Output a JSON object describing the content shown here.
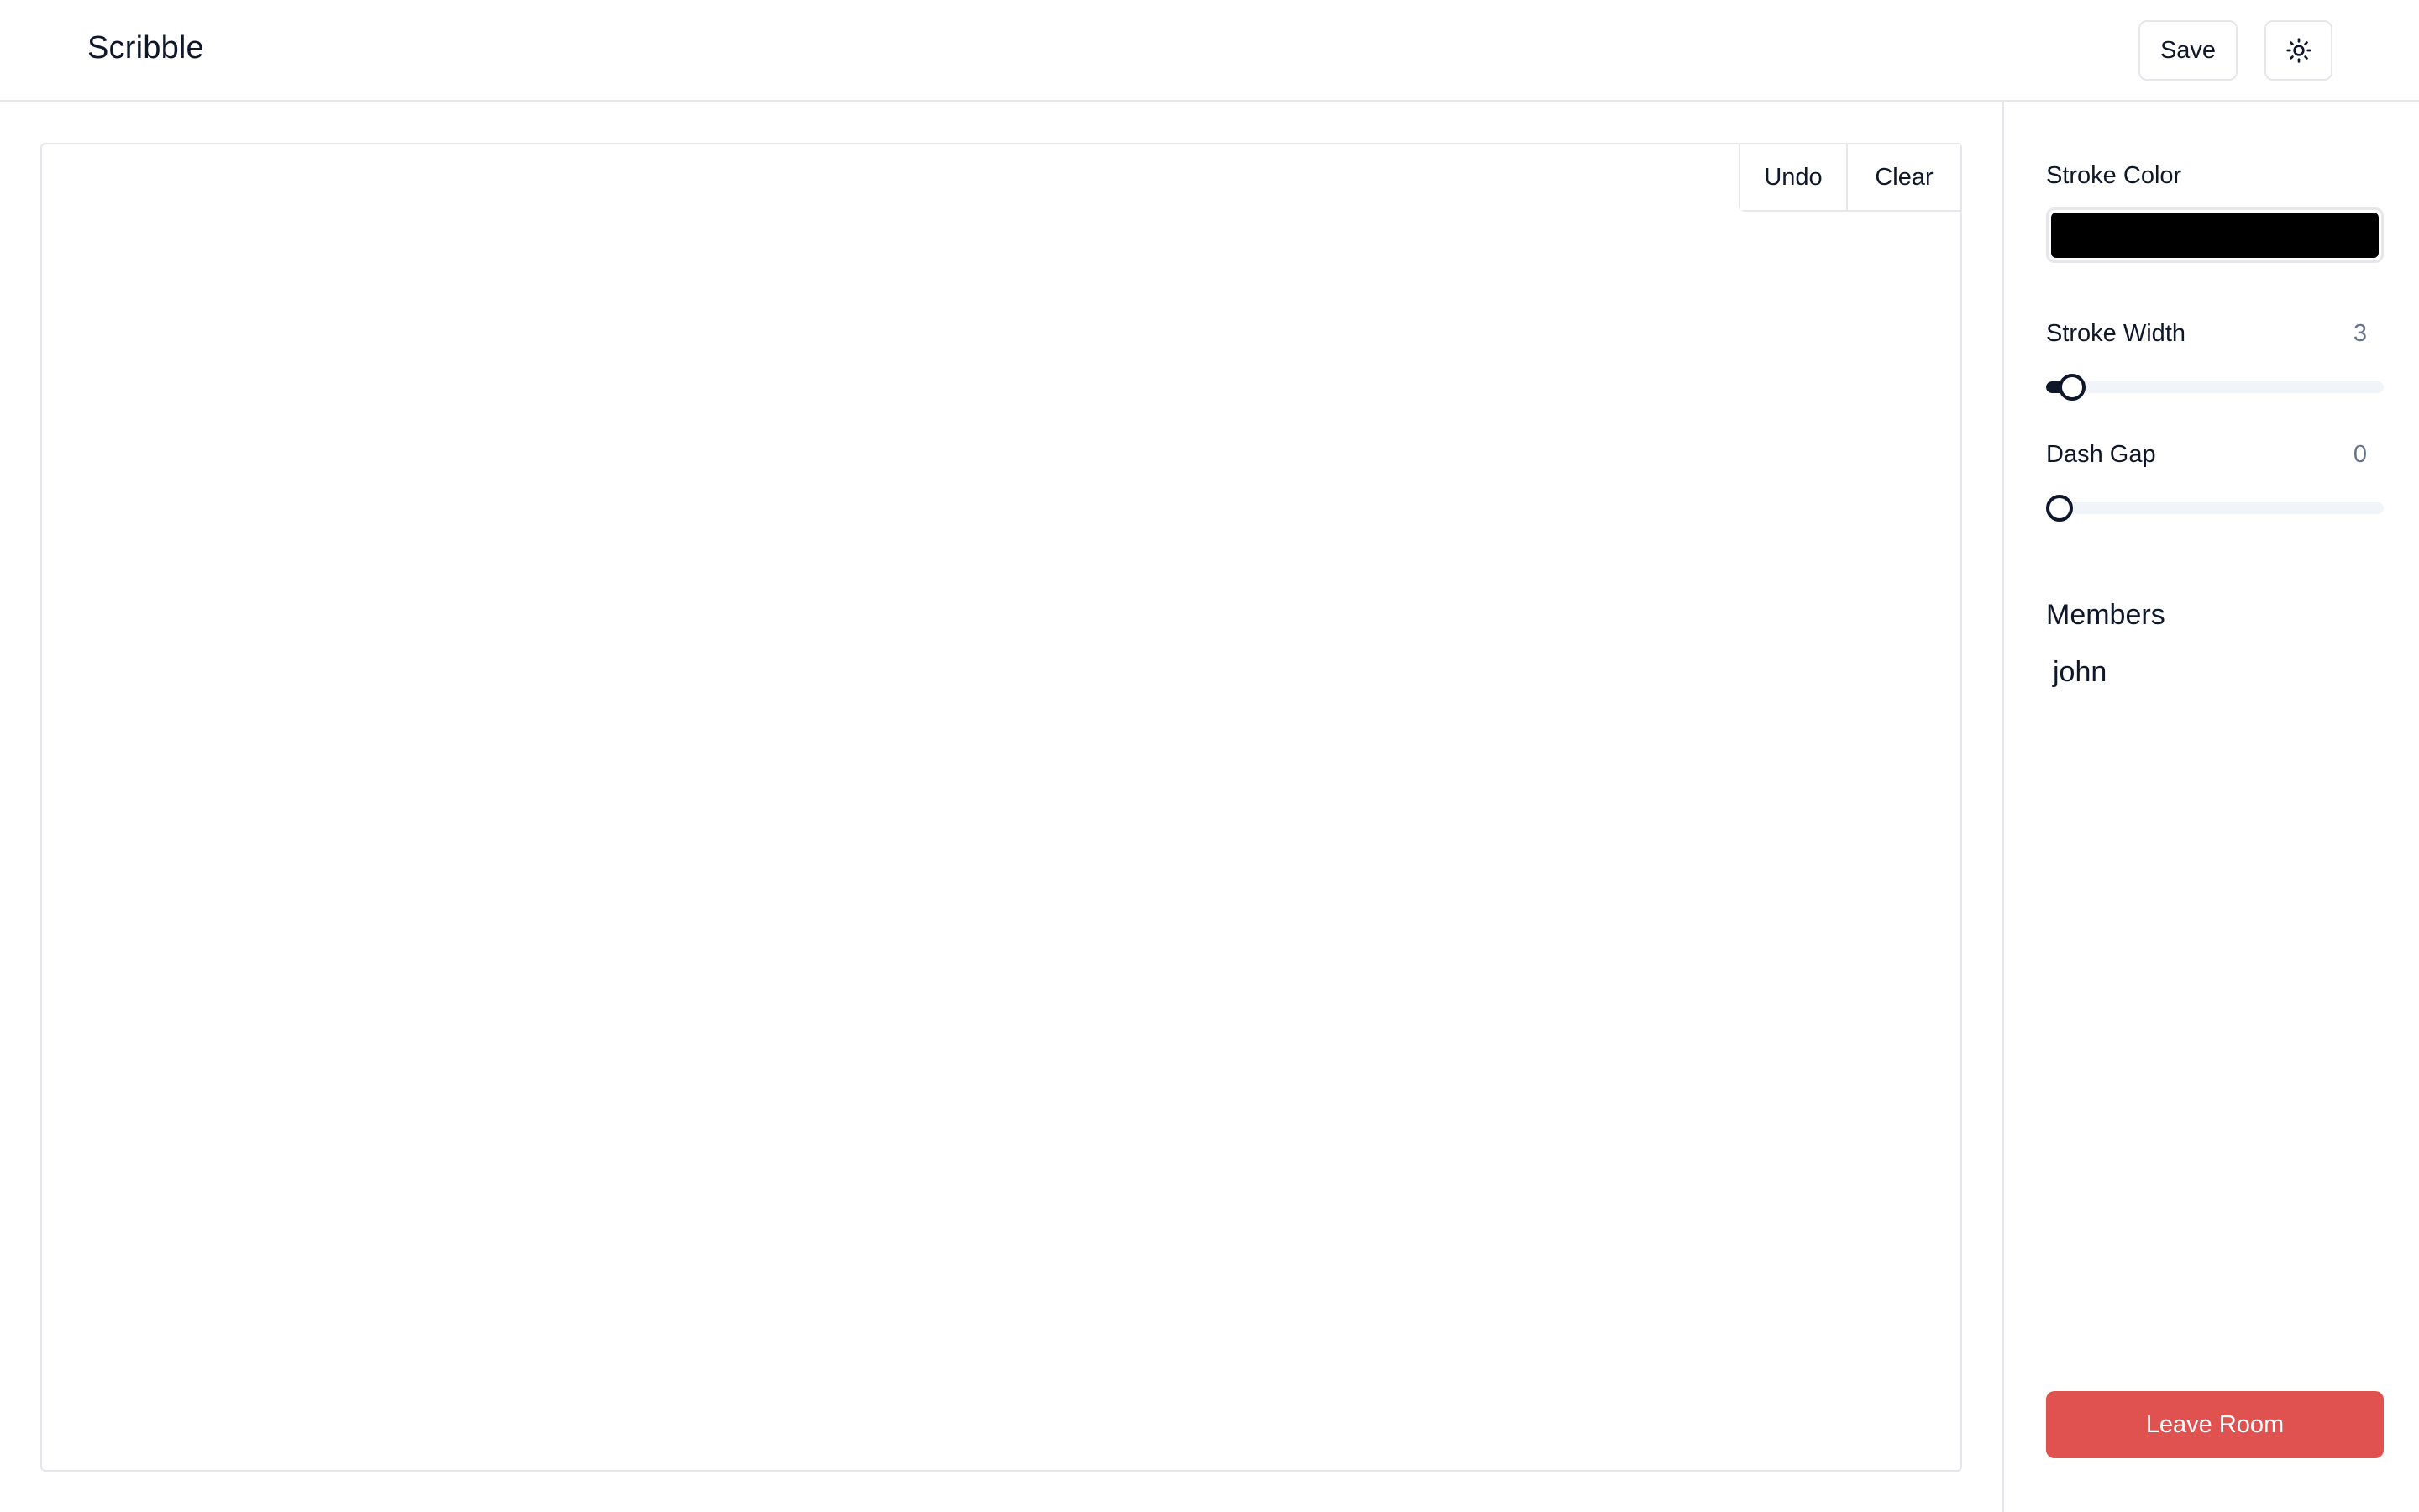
{
  "app": {
    "title": "Scribble"
  },
  "header": {
    "save_label": "Save",
    "theme_icon": "sun-icon"
  },
  "canvas": {
    "undo_label": "Undo",
    "clear_label": "Clear"
  },
  "sidebar": {
    "stroke_color": {
      "label": "Stroke Color",
      "value": "#000000"
    },
    "stroke_width": {
      "label": "Stroke Width",
      "value": "3",
      "min": 1,
      "max": 50,
      "level": 3
    },
    "dash_gap": {
      "label": "Dash Gap",
      "value": "0",
      "min": 0,
      "max": 50,
      "level": 0
    },
    "members": {
      "title": "Members",
      "items": [
        "john"
      ]
    },
    "leave_label": "Leave Room"
  },
  "colors": {
    "accent_danger": "#e0524f",
    "slider_fill": "#0f172a",
    "border": "#e5e7eb"
  }
}
